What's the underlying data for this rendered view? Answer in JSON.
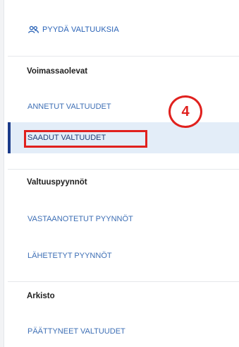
{
  "request_button": {
    "label": "PYYDÄ VALTUUKSIA",
    "icon": "users-icon"
  },
  "sections": {
    "active": "Voimassaolevat",
    "requests": "Valtuuspyynnöt",
    "archive": "Arkisto"
  },
  "nav": {
    "given": "ANNETUT VALTUUDET",
    "received": "SAADUT VALTUUDET",
    "received_requests": "VASTAANOTETUT PYYNNÖT",
    "sent_requests": "LÄHETETYT PYYNNÖT",
    "ended": "PÄÄTTYNEET VALTUUDET"
  },
  "annotation": {
    "step": "4"
  },
  "colors": {
    "link": "#3e6fb5",
    "active_bg": "#e3edf8",
    "active_bar": "#1c3c8a",
    "annotation": "#e0211e"
  }
}
